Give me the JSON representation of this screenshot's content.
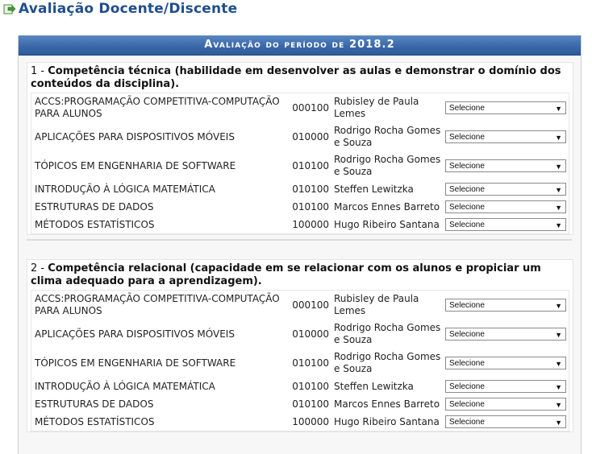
{
  "page": {
    "title": "Avaliação Docente/Discente"
  },
  "panel": {
    "caption": "Avaliação do período de 2018.2"
  },
  "select_placeholder": "Selecione",
  "courses": [
    {
      "name": "ACCS:PROGRAMAÇÃO COMPETITIVA-COMPUTAÇÃO PARA ALUNOS",
      "code": "000100",
      "professor": "Rubisley de Paula Lemes"
    },
    {
      "name": "APLICAÇÕES PARA DISPOSITIVOS MÓVEIS",
      "code": "010000",
      "professor": "Rodrigo Rocha Gomes e Souza"
    },
    {
      "name": "TÓPICOS EM ENGENHARIA DE SOFTWARE",
      "code": "010100",
      "professor": "Rodrigo Rocha Gomes e Souza"
    },
    {
      "name": "INTRODUÇÃO À LÓGICA MATEMÁTICA",
      "code": "010100",
      "professor": "Steffen Lewitzka"
    },
    {
      "name": "ESTRUTURAS DE DADOS",
      "code": "010100",
      "professor": "Marcos Ennes Barreto"
    },
    {
      "name": "MÉTODOS ESTATÍSTICOS",
      "code": "100000",
      "professor": "Hugo Ribeiro Santana"
    }
  ],
  "criteria": [
    {
      "number": "1 - ",
      "title": "Competência técnica (habilidade em desenvolver as aulas e demonstrar o domínio dos conteúdos da disciplina)."
    },
    {
      "number": "2 - ",
      "title": "Competência relacional (capacidade em se relacionar com os alunos e propiciar um clima adequado para a aprendizagem)."
    }
  ]
}
